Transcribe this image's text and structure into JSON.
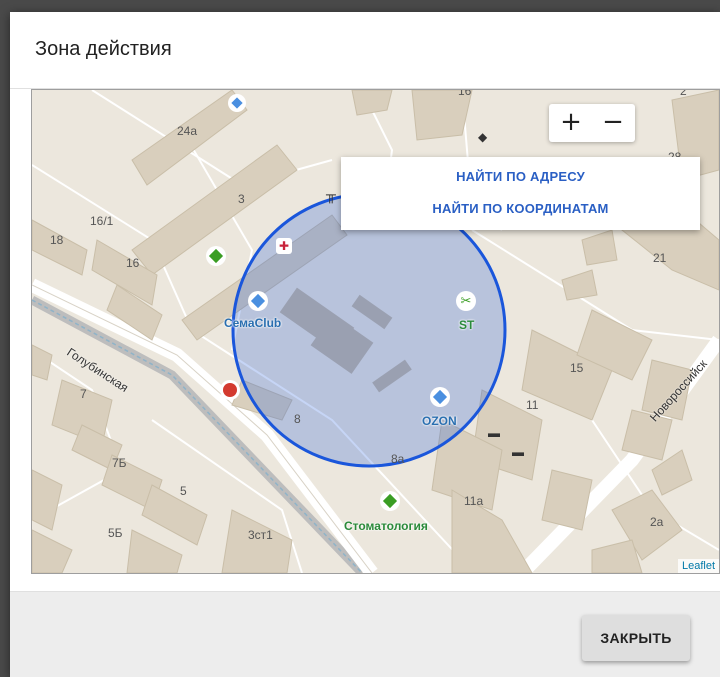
{
  "dialog": {
    "title": "Зона действия",
    "close_label": "ЗАКРЫТЬ"
  },
  "map": {
    "zoom_in_label": "+",
    "zoom_out_label": "−",
    "find_by_address": "НАЙТИ ПО АДРЕСУ",
    "find_by_coordinates": "НАЙТИ ПО КООРДИНАТАМ",
    "attribution": "Leaflet",
    "street_labels": {
      "golubinskaya": "Голубинская",
      "novorossiyskaya": "Новороссийск"
    },
    "house_numbers": {
      "n24a": "24а",
      "n3": "3",
      "n16_1": "16/1",
      "n18": "18",
      "n16": "16",
      "n21": "21",
      "n15": "15",
      "n11": "11",
      "n7": "7",
      "n8": "8",
      "n7b": "7Б",
      "n5": "5",
      "n5b": "5Б",
      "n3s1": "3ст1",
      "n11a": "11а",
      "n8a": "8а",
      "n2a": "2а",
      "n16t": "16",
      "n28": "28",
      "n2t": "2"
    },
    "poi_labels": {
      "semaclub": "СемаClub",
      "st": "ST",
      "ozon": "OZON",
      "stomatologia": "Стоматология"
    },
    "zone_color": "#1a56db"
  }
}
